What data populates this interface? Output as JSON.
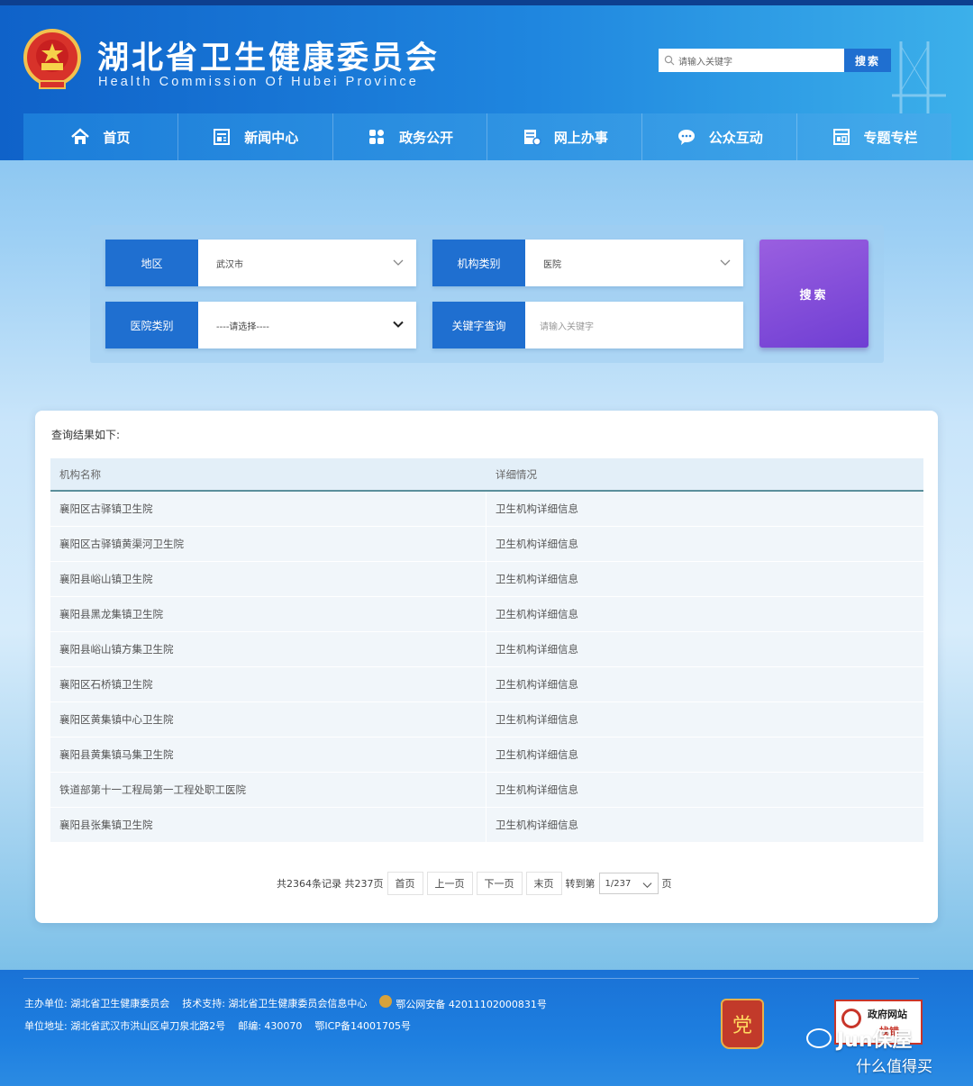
{
  "header": {
    "title": "湖北省卫生健康委员会",
    "subtitle": "Health Commission Of Hubei Province",
    "search_placeholder": "请输入关键字",
    "search_button": "搜索"
  },
  "nav": [
    {
      "label": "首页",
      "icon": "home-icon"
    },
    {
      "label": "新闻中心",
      "icon": "news-icon"
    },
    {
      "label": "政务公开",
      "icon": "grid-icon"
    },
    {
      "label": "网上办事",
      "icon": "document-icon"
    },
    {
      "label": "公众互动",
      "icon": "chat-icon"
    },
    {
      "label": "专题专栏",
      "icon": "topic-icon"
    }
  ],
  "filters": {
    "region_label": "地区",
    "region_value": "武汉市",
    "org_type_label": "机构类别",
    "org_type_value": "医院",
    "hospital_type_label": "医院类别",
    "hospital_type_value": "----请选择----",
    "keyword_label": "关键字查询",
    "keyword_placeholder": "请输入关键字",
    "search_button": "搜索"
  },
  "results": {
    "heading": "查询结果如下:",
    "columns": [
      "机构名称",
      "详细情况"
    ],
    "rows": [
      {
        "name": "襄阳区古驿镇卫生院",
        "detail": "卫生机构详细信息"
      },
      {
        "name": "襄阳区古驿镇黄渠河卫生院",
        "detail": "卫生机构详细信息"
      },
      {
        "name": "襄阳县峪山镇卫生院",
        "detail": "卫生机构详细信息"
      },
      {
        "name": "襄阳县黑龙集镇卫生院",
        "detail": "卫生机构详细信息"
      },
      {
        "name": "襄阳县峪山镇方集卫生院",
        "detail": "卫生机构详细信息"
      },
      {
        "name": "襄阳区石桥镇卫生院",
        "detail": "卫生机构详细信息"
      },
      {
        "name": "襄阳区黄集镇中心卫生院",
        "detail": "卫生机构详细信息"
      },
      {
        "name": "襄阳县黄集镇马集卫生院",
        "detail": "卫生机构详细信息"
      },
      {
        "name": "铁道部第十一工程局第一工程处职工医院",
        "detail": "卫生机构详细信息"
      },
      {
        "name": "襄阳县张集镇卫生院",
        "detail": "卫生机构详细信息"
      }
    ]
  },
  "pager": {
    "summary": "共2364条记录 共237页",
    "first": "首页",
    "prev": "上一页",
    "next": "下一页",
    "last": "末页",
    "goto_label": "转到第",
    "page_value": "1/237",
    "page_suffix": "页"
  },
  "footer": {
    "sponsor": "主办单位: 湖北省卫生健康委员会",
    "tech": "技术支持: 湖北省卫生健康委员会信息中心",
    "police_record": "鄂公网安备 42011102000831号",
    "address": "单位地址: 湖北省武汉市洪山区卓刀泉北路2号",
    "postcode": "邮编: 430070",
    "icp": "鄂ICP备14001705号",
    "error_badge_line1": "政府网站",
    "error_badge_line2": "找错"
  },
  "watermark": {
    "line1": "Jun保屋",
    "line2": "什么值得买"
  },
  "colors": {
    "brand_blue": "#1f6fd0",
    "search_purple": "#7b45d8",
    "footer_blue": "#1e7fe0"
  }
}
